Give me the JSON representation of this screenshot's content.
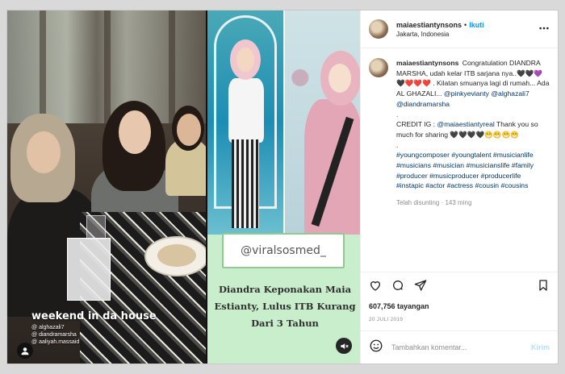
{
  "post": {
    "username": "maiaestiantynsons",
    "separator": "•",
    "follow_label": "Ikuti",
    "location": "Jakarta, Indonesia",
    "more_icon": "more-horizontal-icon"
  },
  "media": {
    "left_caption": "weekend in da house",
    "left_tags": [
      "alghazali7",
      "diandramarsha",
      "aaliyah.massaid"
    ],
    "right_handle": "@viralsosmed_",
    "right_headline": "Diandra Keponakan Maia Estianty, Lulus ITB Kurang Dari 3 Tahun",
    "mute_icon": "speaker-muted-icon",
    "left_avatar_icon": "instagram-profile-icon"
  },
  "caption": {
    "username": "maiaestiantynsons",
    "part1": "Congratulation DIANDRA MARSHA, udah kelar ITB sarjana nya..🖤🖤💜🖤❤️❤️❤️",
    "part2": ". Kilatan smuanya lagi di rumah... Ada AL GHAZALI...",
    "mention1": "@pinkyevianty",
    "mention2": "@alghazali7",
    "mention3": "@diandramarsha",
    "dot": ".",
    "credit": "CREDIT IG :",
    "mention4": "@maiaestiantyreal",
    "thanks": "Thank you so much for sharing 🖤🖤🖤🖤😁😁😁😁",
    "dot2": ".",
    "hashtags": "#youngcomposer #youngtalent #musicianlife #musicians #musician #musicianslife #family #producer #musicproducer #producerlife #instapic #actor #actress #cousin #cousins",
    "edited_meta": "Telah disunting · 143 ming"
  },
  "actions": {
    "like_icon": "heart-icon",
    "comment_icon": "comment-icon",
    "share_icon": "send-icon",
    "save_icon": "bookmark-icon"
  },
  "stats": {
    "views": "607,756 tayangan",
    "date": "20 JULI 2019"
  },
  "comment_input": {
    "emoji_icon": "smiley-icon",
    "placeholder": "Tambahkan komentar...",
    "post_label": "Kirim"
  }
}
